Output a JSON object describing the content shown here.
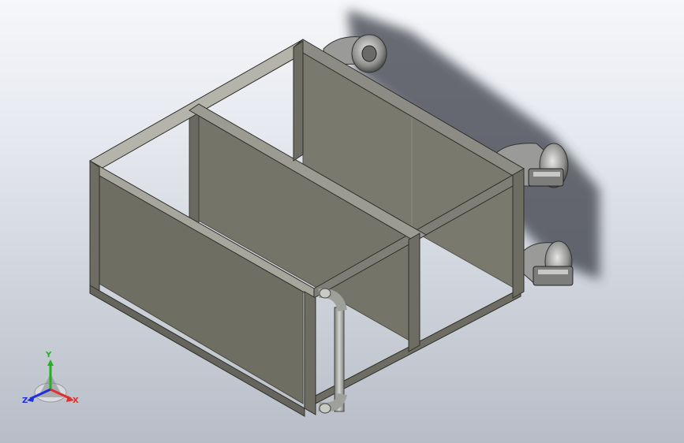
{
  "viewport": {
    "model_icon": "cad-assembly-cart-frame",
    "background_top": "#f6f7fa",
    "background_bottom": "#b7bdc7"
  },
  "colors": {
    "frame": "#6d6d64",
    "frame_highlight": "#b9b9b0",
    "panel": "#76756a",
    "panel_dark": "#66665c",
    "handle": "#9ea09a",
    "caster": "#888a88",
    "shadow": "#3a3e46"
  },
  "triad": {
    "icon": "coordinate-triad-icon",
    "x_label": "X",
    "y_label": "Y",
    "z_label": "Z",
    "x_color": "#e03030",
    "y_color": "#20b020",
    "z_color": "#2030d8"
  }
}
